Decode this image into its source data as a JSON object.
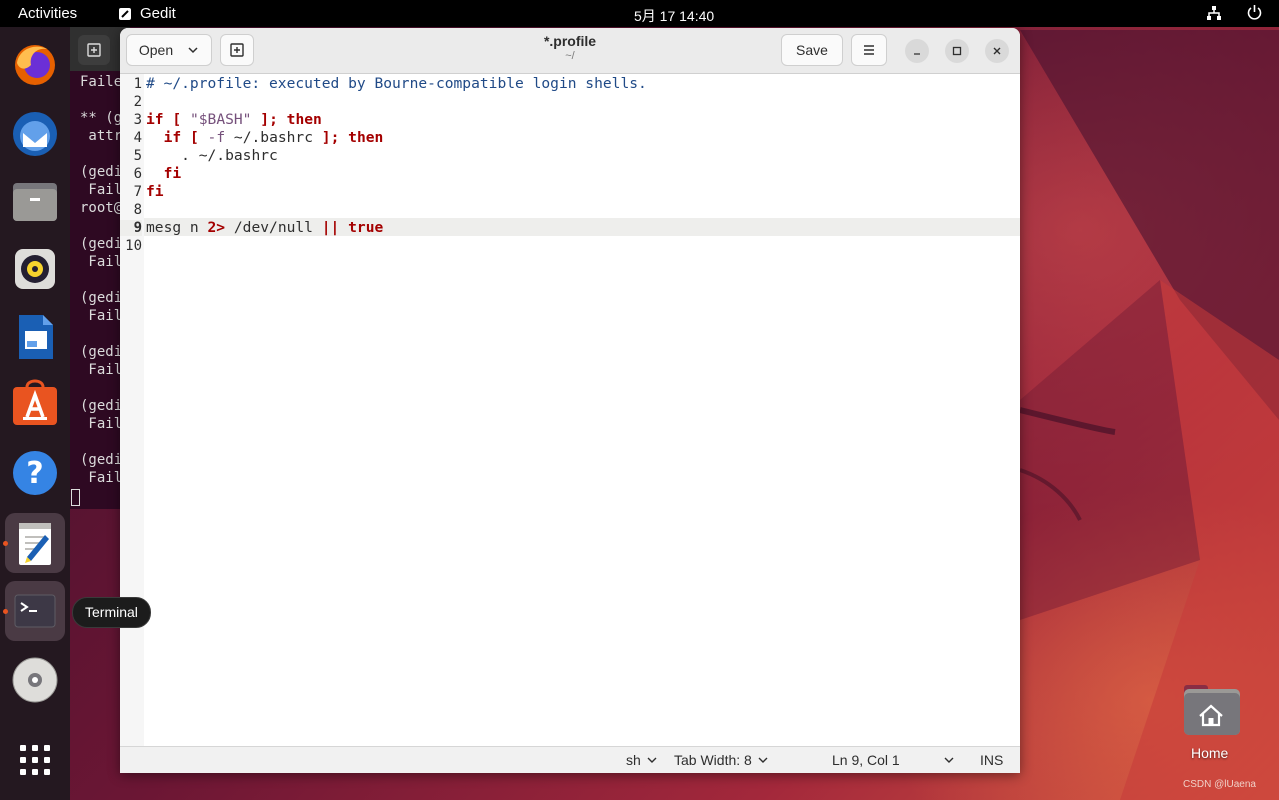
{
  "topbar": {
    "activities": "Activities",
    "app_name": "Gedit",
    "clock": "5月 17  14:40"
  },
  "dock": {
    "items": [
      "firefox-icon",
      "thunderbird-icon",
      "files-icon",
      "rhythmbox-icon",
      "libreoffice-writer-icon",
      "app-center-icon",
      "help-icon",
      "text-editor-icon",
      "terminal-icon",
      "disc-icon",
      "show-apps-icon"
    ]
  },
  "tooltip": "Terminal",
  "terminal": {
    "lines": [
      "Faile",
      "",
      "** (ge",
      " attri",
      "",
      "(gedi",
      " Faile",
      "root@r",
      "",
      "(gedi",
      " Faile",
      "",
      "(gedi",
      " Faile",
      "",
      "(gedi",
      " Faile",
      "",
      "(gedi",
      " Faile",
      "",
      "(gedi",
      " Faile"
    ]
  },
  "gedit": {
    "open_label": "Open",
    "title": "*.profile",
    "path": "~/",
    "save_label": "Save",
    "lines": [
      {
        "n": "1"
      },
      {
        "n": "2"
      },
      {
        "n": "3"
      },
      {
        "n": "4"
      },
      {
        "n": "5"
      },
      {
        "n": "6"
      },
      {
        "n": "7"
      },
      {
        "n": "8"
      },
      {
        "n": "9"
      },
      {
        "n": "10"
      }
    ],
    "code": {
      "l1": "# ~/.profile: executed by Bourne-compatible login shells.",
      "l3_if": "if",
      "l3_br": "[",
      "l3_str": "\"$BASH\"",
      "l3_end": "];",
      "l3_then": "then",
      "l4_if": "if",
      "l4_br": "[",
      "l4_flag": "-f",
      "l4_path": "~/.bashrc",
      "l4_end": "];",
      "l4_then": "then",
      "l5": ". ~/.bashrc",
      "l6": "fi",
      "l7": "fi",
      "l9_cmd": "mesg n",
      "l9_redir": "2>",
      "l9_dev": "/dev/null",
      "l9_or": "||",
      "l9_true": "true"
    },
    "status": {
      "language": "sh",
      "tab_width": "Tab Width: 8",
      "position": "Ln 9, Col 1",
      "mode": "INS"
    }
  },
  "desktop": {
    "home_label": "Home",
    "watermark": "CSDN @lUaena"
  },
  "colors": {
    "accent": "#e95420",
    "keyword": "#a40000",
    "comment": "#204a87",
    "string": "#75507b"
  }
}
